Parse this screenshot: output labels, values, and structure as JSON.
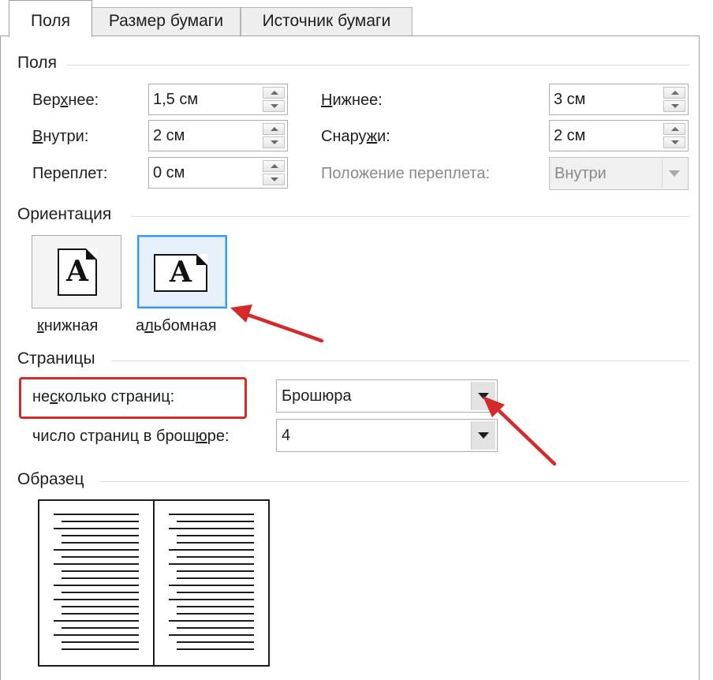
{
  "tabs": [
    {
      "label": "Поля",
      "active": true
    },
    {
      "label": "Размер бумаги",
      "active": false
    },
    {
      "label": "Источник бумаги",
      "active": false
    }
  ],
  "margins": {
    "group_title": "Поля",
    "top": {
      "label_pre": "Вер",
      "label_key": "х",
      "label_post": "нее:",
      "value": "1,5 см"
    },
    "bottom": {
      "label_pre": "",
      "label_key": "Н",
      "label_post": "ижнее:",
      "value": "3 см"
    },
    "inside": {
      "label_pre": "",
      "label_key": "В",
      "label_post": "нутри:",
      "value": "2 см"
    },
    "outside": {
      "label_pre": "Снару",
      "label_key": "ж",
      "label_post": "и:",
      "value": "2 см"
    },
    "gutter": {
      "label_pre": "Переплет",
      "label_key": "",
      "label_post": ":",
      "value": "0 см"
    },
    "gutter_position": {
      "label": "Положение переплета:",
      "value": "Внутри"
    }
  },
  "orientation": {
    "group_title": "Ориентация",
    "icon_letter": "A",
    "portrait": {
      "label_key": "к",
      "label_post": "нижная"
    },
    "landscape": {
      "label_pre": "а",
      "label_key": "л",
      "label_post": "ьбомная"
    }
  },
  "pages": {
    "group_title": "Страницы",
    "multiple": {
      "label_pre": "не",
      "label_key": "с",
      "label_post": "колько страниц:",
      "value": "Брошюра"
    },
    "sheets_per_booklet": {
      "label_pre": "число страниц в брош",
      "label_key": "ю",
      "label_post": "ре:",
      "value": "4"
    }
  },
  "preview": {
    "group_title": "Образец"
  },
  "colors": {
    "annotation_red": "#d42a2a",
    "selection_blue": "#3399ff"
  }
}
